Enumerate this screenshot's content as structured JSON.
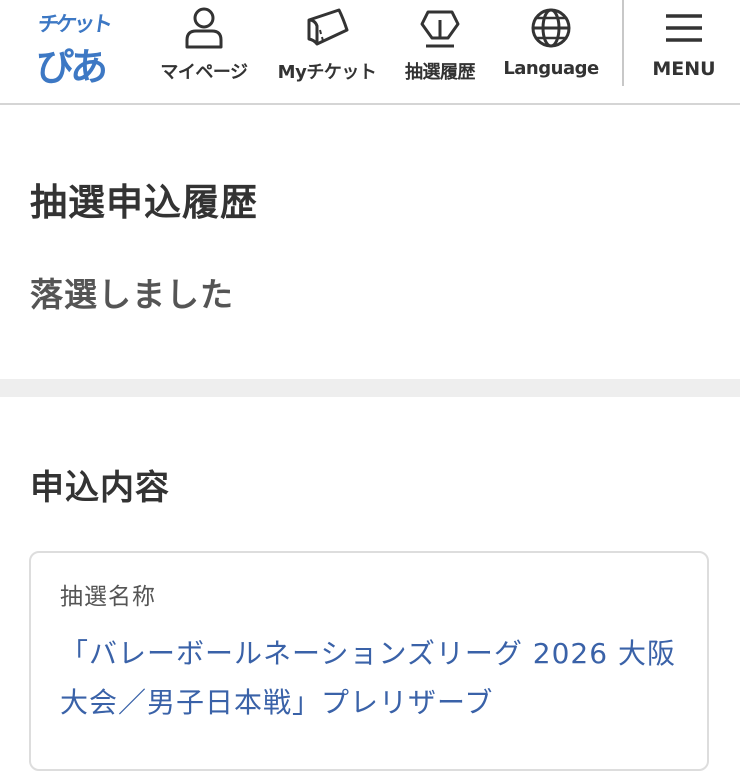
{
  "header": {
    "logo": {
      "top": "チケット",
      "bottom": "ぴあ",
      "color": "#3d78c4"
    },
    "nav": [
      {
        "label": "マイページ",
        "icon": "person-icon"
      },
      {
        "label": "Myチケット",
        "icon": "ticket-icon"
      },
      {
        "label": "抽選履歴",
        "icon": "lottery-icon"
      },
      {
        "label": "Language",
        "icon": "globe-icon"
      }
    ],
    "menu": {
      "label": "MENU",
      "icon": "hamburger-icon"
    }
  },
  "main": {
    "title": "抽選申込履歴",
    "status": "落選しました",
    "section_title": "申込内容",
    "card": {
      "label": "抽選名称",
      "value": "「バレーボールネーションズリーグ 2026 大阪大会／男子日本戦」プレリザーブ"
    }
  },
  "colors": {
    "brand": "#3d78c4",
    "link": "#3a62a8",
    "text": "#333333",
    "band": "#eeeeee"
  }
}
